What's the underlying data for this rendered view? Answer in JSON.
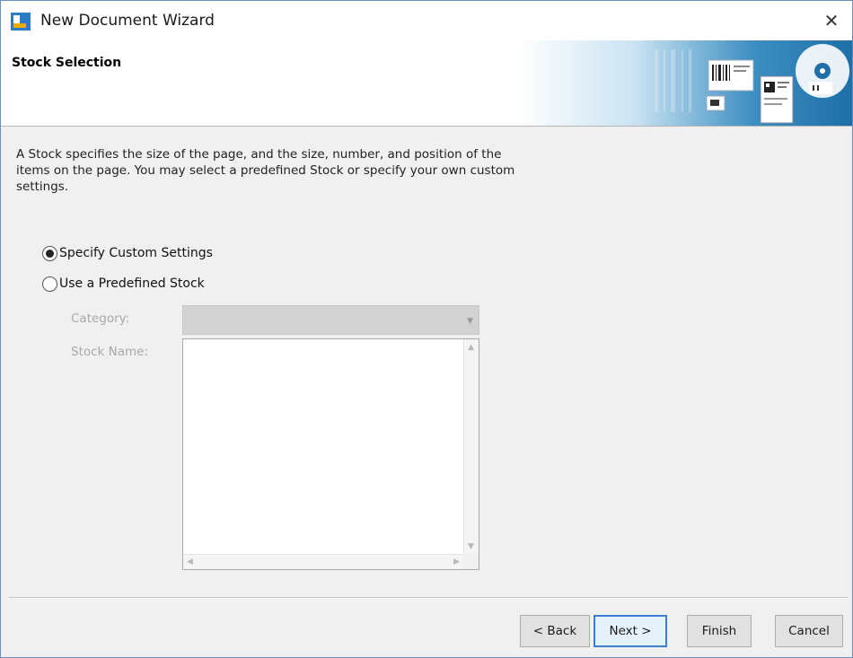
{
  "window": {
    "title": "New Document Wizard",
    "close_glyph": "✕",
    "icon": "app-logo-icon"
  },
  "header": {
    "title": "Stock Selection",
    "art_icon": "label-stock-illustration-icon"
  },
  "description": "A Stock specifies the size of the page, and the size, number, and position of the items on the page. You may select a predefined Stock or specify your own custom settings.",
  "options": {
    "custom": {
      "label": "Specify Custom Settings",
      "checked": true
    },
    "predefined": {
      "label": "Use a Predefined Stock",
      "checked": false
    }
  },
  "fields": {
    "category_label": "Category:",
    "category_value": "",
    "stock_name_label": "Stock Name:"
  },
  "buttons": {
    "back": "< Back",
    "next": "Next >",
    "finish": "Finish",
    "cancel": "Cancel"
  },
  "colors": {
    "accent": "#3b7fd1",
    "disabled_text": "#a8a8a8"
  }
}
